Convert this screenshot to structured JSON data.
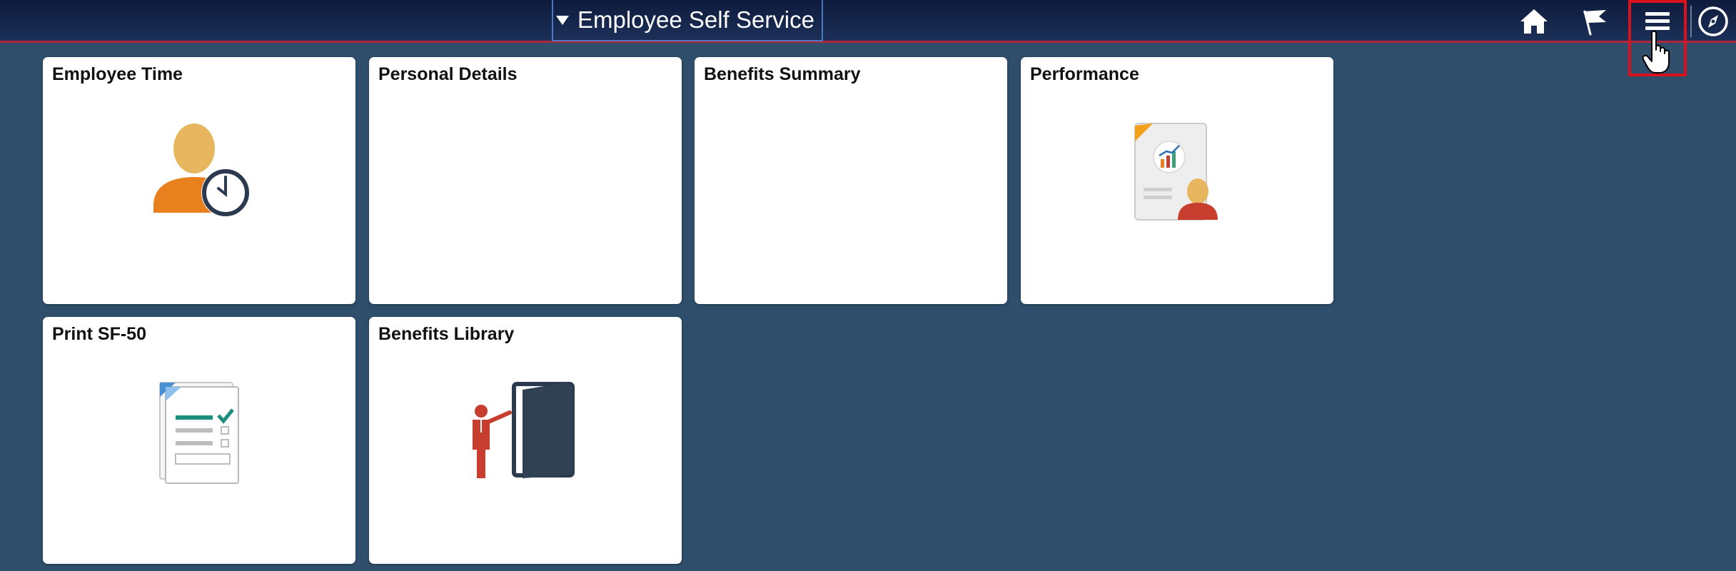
{
  "header": {
    "homepage_title": "Employee Self Service",
    "icons": [
      "home-icon",
      "flag-icon",
      "menu-icon",
      "navbar-compass-icon"
    ],
    "accent_color": "#b0263a",
    "highlight_color": "#d8121c"
  },
  "tiles": [
    {
      "title": "Employee Time",
      "icon": "employee-time-icon"
    },
    {
      "title": "Personal Details",
      "icon": ""
    },
    {
      "title": "Benefits Summary",
      "icon": ""
    },
    {
      "title": "Performance",
      "icon": "performance-document-icon"
    },
    {
      "title": "Print SF-50",
      "icon": "print-checklist-icon"
    },
    {
      "title": "Benefits Library",
      "icon": "library-presenter-icon"
    }
  ],
  "colors": {
    "background": "#2e4e6c",
    "header_gradient_top": "#0e1b3c",
    "header_gradient_bottom": "#1c3058",
    "tile_background": "#ffffff"
  }
}
